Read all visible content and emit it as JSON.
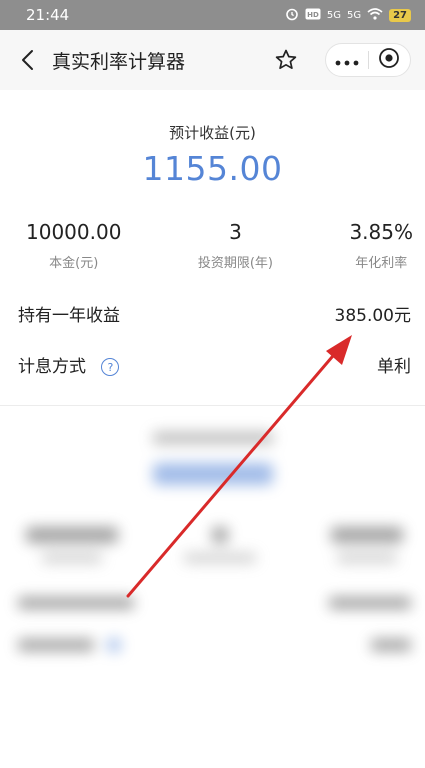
{
  "status": {
    "time": "21:44",
    "icons": [
      "alarm-icon",
      "hd-icon",
      "signal-5g-icon",
      "signal-5g-icon",
      "wifi-icon"
    ],
    "network_1": "5G",
    "network_2": "5G",
    "battery": "27"
  },
  "nav": {
    "title": "真实利率计算器"
  },
  "result": {
    "label": "预计收益(元)",
    "value": "1155.00"
  },
  "stats": [
    {
      "value": "10000.00",
      "label": "本金(元)"
    },
    {
      "value": "3",
      "label": "投资期限(年)"
    },
    {
      "value": "3.85%",
      "label": "年化利率"
    }
  ],
  "rows": {
    "annual_label": "持有一年收益",
    "annual_value": "385.00元",
    "method_label": "计息方式",
    "method_help": "?",
    "method_value": "单利"
  },
  "colors": {
    "accent": "#5585d6",
    "arrow": "#d92a2a",
    "status_bar": "#8e8e8e"
  }
}
